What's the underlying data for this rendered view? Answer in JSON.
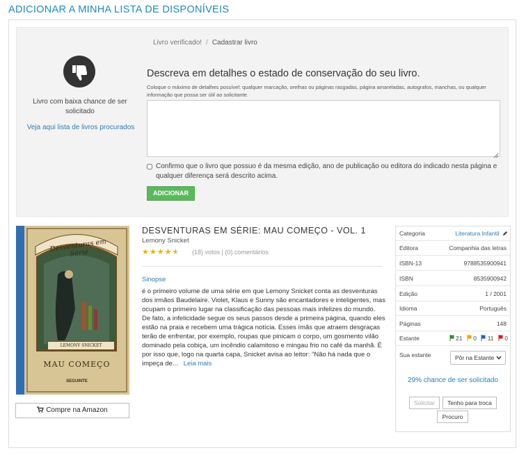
{
  "page_title": "ADICIONAR A MINHA LISTA DE DISPONÍVEIS",
  "left_panel": {
    "icon": "thumbs-down-icon",
    "low_chance_text": "Livro com baixa chance de ser solicitado",
    "see_list_link": "Veja aqui lista de livros procurados"
  },
  "breadcrumb": [
    "Livro verificado!",
    "Cadastrar livro"
  ],
  "form": {
    "title": "Descreva em detalhes o estado de conservação do seu livro.",
    "hint": "Coloque o máximo de detalhes possível: qualquer marcação, orelhas ou páginas rasgadas, página amareladas, autografos, manchas, ou qualquer informação que possa ser útil ao solicitante.",
    "textarea_value": "",
    "confirm_text": "Confirmo que o livro que possuo é da mesma edição, ano de publicação ou editora do indicado nesta página e qualquer diferença será descrito acima.",
    "add_button": "ADICIONAR"
  },
  "book": {
    "cover_title": "Desventuras em Série",
    "cover_author": "LEMONY SNICKET",
    "cover_subtitle": "MAU COMEÇO",
    "cover_publisher": "SEGUINTE",
    "title": "DESVENTURAS EM SÉRIE: MAU COMEÇO - VOL. 1",
    "author": "Lemony Snicket",
    "rating": 4.5,
    "votes": "(18) votos",
    "comments": "(0) comentários",
    "sinopse_label": "Sinopse",
    "synopsis": "é o primeiro volume de uma série em que Lemony Snicket conta as desventuras dos irmãos Baudelaire. Violet, Klaus e Sunny são encantadores e inteligentes, mas ocupam o primeiro lugar na classificação das pessoas mais infelizes do mundo. De fato, a infelicidade segue os seus passos desde a primeira página, quando eles estão na praia e recebem uma trágica notícia. Esses ímãs que atraem desgraças terão de enfrentar, por exemplo, roupas que pinicam o corpo, um gosmento vilão dominado pela cobiça, um incêndio calamitoso e mingau frio no café da manhã. É por isso que, logo na quarta capa, Snicket avisa ao leitor: \"Não há nada que o impeça de...",
    "read_more": "Leia mais",
    "amazon_button": "Compre na Amazon"
  },
  "info": {
    "categoria_label": "Categoria",
    "categoria_value": "Literatura Infantil",
    "editora_label": "Editora",
    "editora_value": "Companhia das letras",
    "isbn13_label": "ISBN-13",
    "isbn13_value": "9788535900941",
    "isbn_label": "ISBN",
    "isbn_value": "8535900942",
    "edicao_label": "Edição",
    "edicao_value": "1 / 2001",
    "idioma_label": "Idioma",
    "idioma_value": "Português",
    "paginas_label": "Páginas",
    "paginas_value": "148",
    "estante_label": "Estante",
    "estante_counts": [
      {
        "count": "21",
        "color": "#2e8b2e"
      },
      {
        "count": "0",
        "color": "#f0a500"
      },
      {
        "count": "11",
        "color": "#1f5fd0"
      },
      {
        "count": "0",
        "color": "#d41c1c"
      }
    ],
    "sua_estante_label": "Sua estante",
    "shelf_select_value": "Pôr na Estante",
    "chance_text": "29% chance de ser solicitado",
    "btn_solicitar": "Solicitar",
    "btn_troca": "Tenho para troca",
    "btn_procuro": "Procuro"
  }
}
